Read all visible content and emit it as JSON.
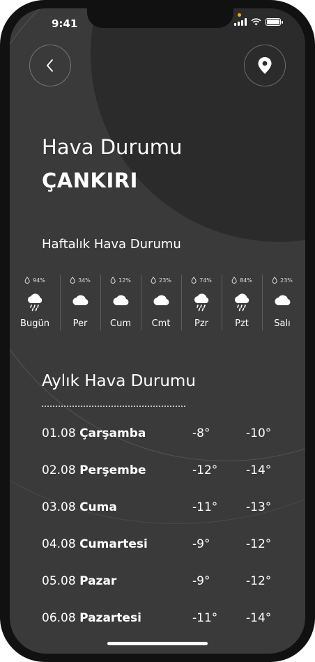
{
  "status": {
    "time": "9:41"
  },
  "header": {
    "title": "Hava Durumu",
    "city": "ÇANKIRI"
  },
  "weekly": {
    "title": "Haftalık Hava Durumu",
    "days": [
      {
        "name": "Bugün",
        "precip": "94%",
        "icon": "cloud-rain-icon"
      },
      {
        "name": "Per",
        "precip": "34%",
        "icon": "cloud-icon"
      },
      {
        "name": "Cum",
        "precip": "12%",
        "icon": "cloud-icon"
      },
      {
        "name": "Cmt",
        "precip": "23%",
        "icon": "cloud-icon"
      },
      {
        "name": "Pzr",
        "precip": "74%",
        "icon": "cloud-rain-icon"
      },
      {
        "name": "Pzt",
        "precip": "84%",
        "icon": "cloud-rain-icon"
      },
      {
        "name": "Salı",
        "precip": "23%",
        "icon": "cloud-icon"
      }
    ]
  },
  "monthly": {
    "title": "Aylık Hava Durumu",
    "rows": [
      {
        "date": "01.08",
        "day": "Çarşamba",
        "t1": "-8°",
        "t2": "-10°"
      },
      {
        "date": "02.08",
        "day": "Perşembe",
        "t1": "-12°",
        "t2": "-14°"
      },
      {
        "date": "03.08",
        "day": "Cuma",
        "t1": "-11°",
        "t2": "-13°"
      },
      {
        "date": "04.08",
        "day": "Cumartesi",
        "t1": "-9°",
        "t2": "-12°"
      },
      {
        "date": "05.08",
        "day": "Pazar",
        "t1": "-9°",
        "t2": "-12°"
      },
      {
        "date": "06.08",
        "day": "Pazartesi",
        "t1": "-11°",
        "t2": "-14°"
      }
    ]
  }
}
